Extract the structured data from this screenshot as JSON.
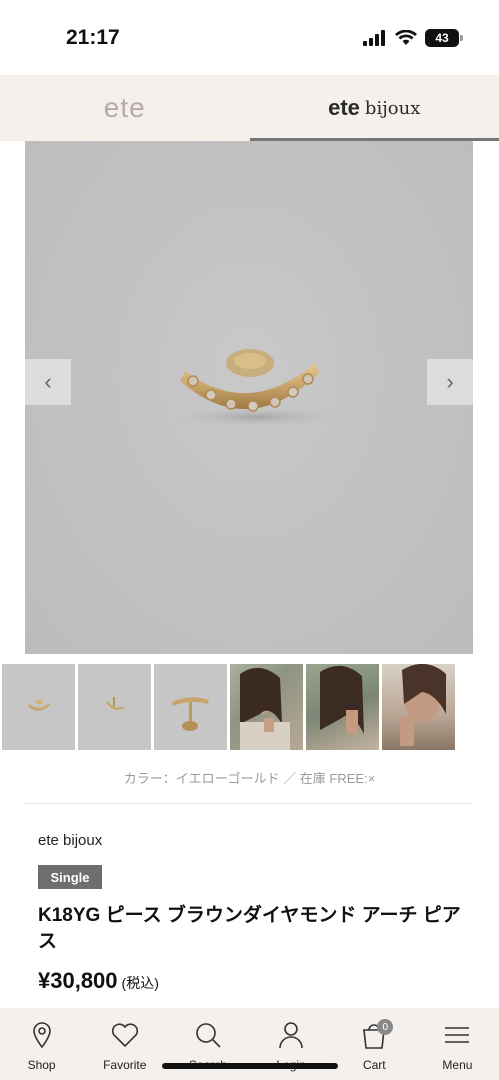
{
  "status": {
    "time": "21:17",
    "battery": "43"
  },
  "brand_tabs": [
    {
      "label": "ete"
    },
    {
      "label": "ete",
      "sub": "bijoux",
      "active": true
    }
  ],
  "gallery": {
    "prev_icon": "chevron-left-icon",
    "next_icon": "chevron-right-icon",
    "thumbnails": 6
  },
  "variant_info": "カラー：イエローゴールド ／ 在庫 FREE:×",
  "product": {
    "brand": "ete bijoux",
    "badge": "Single",
    "title": "K18YG ピース ブラウンダイヤモンド アーチ ピアス",
    "price": "¥30,800",
    "tax_note": "(税込)"
  },
  "bottom_nav": [
    {
      "label": "Shop",
      "icon": "map-pin-icon"
    },
    {
      "label": "Favorite",
      "icon": "heart-icon"
    },
    {
      "label": "Search",
      "icon": "search-icon"
    },
    {
      "label": "Login",
      "icon": "user-icon"
    },
    {
      "label": "Cart",
      "icon": "shopping-bag-icon",
      "count": "0"
    },
    {
      "label": "Menu",
      "icon": "hamburger-menu-icon"
    }
  ],
  "colors": {
    "brand_bg": "#f5f0ec",
    "badge_bg": "#6e6e6e",
    "accent_gold": "#c9a46a"
  }
}
